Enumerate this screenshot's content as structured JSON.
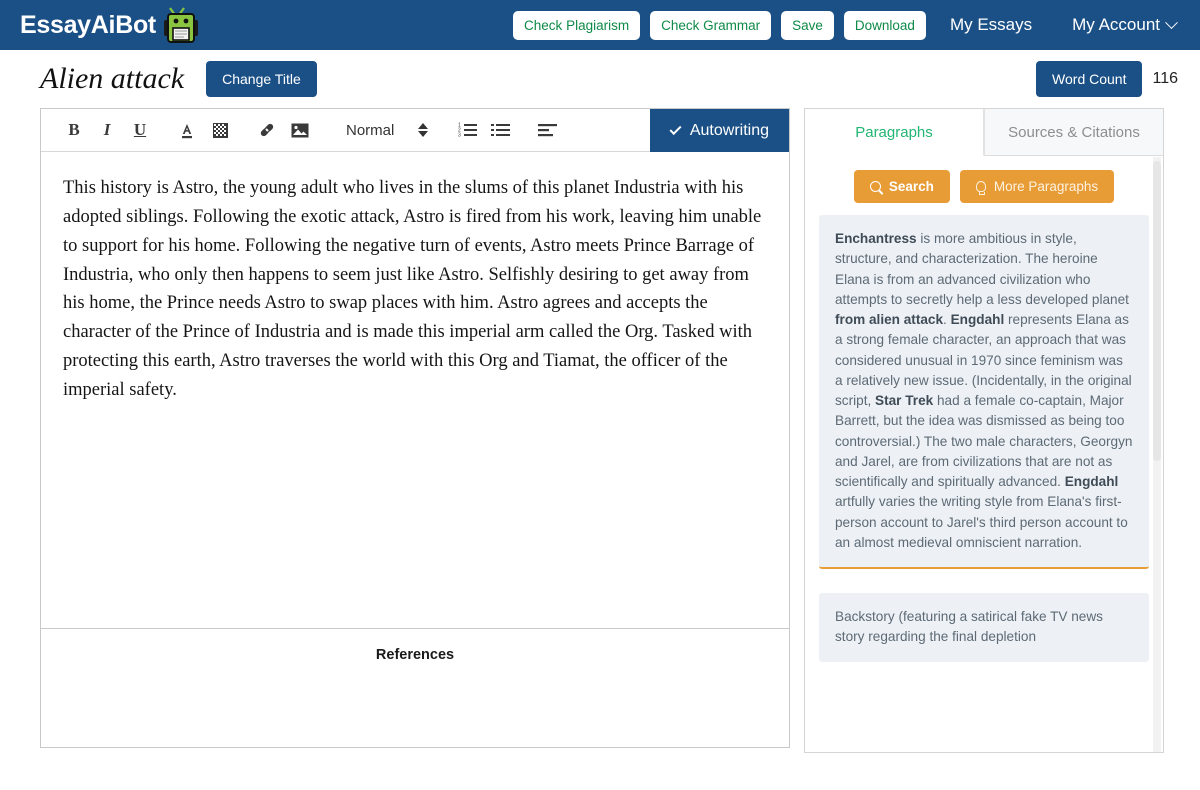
{
  "brand": {
    "name": "EssayAiBot",
    "logo_icon": "robot-icon"
  },
  "nav": {
    "buttons": [
      {
        "label": "Check Plagiarism",
        "name": "check-plagiarism-button"
      },
      {
        "label": "Check Grammar",
        "name": "check-grammar-button"
      },
      {
        "label": "Save",
        "name": "save-button"
      },
      {
        "label": "Download",
        "name": "download-button"
      }
    ],
    "links": [
      {
        "label": "My Essays"
      },
      {
        "label": "My Account"
      }
    ],
    "account_caret_icon": "chevron-down-icon"
  },
  "title_row": {
    "doc_title": "Alien attack",
    "change_title_label": "Change Title",
    "word_count_label": "Word Count",
    "word_count_value": "116"
  },
  "toolbar": {
    "icons": [
      {
        "name": "bold-icon",
        "glyph": "B"
      },
      {
        "name": "italic-icon",
        "glyph": "I"
      },
      {
        "name": "underline-icon",
        "glyph": "U"
      },
      {
        "name": "text-color-icon",
        "glyph": "A"
      },
      {
        "name": "highlight-color-icon",
        "glyph": "▒"
      },
      {
        "name": "link-icon",
        "glyph": "ὑ7"
      },
      {
        "name": "image-icon",
        "glyph": "ὛC"
      },
      {
        "name": "ordered-list-icon",
        "glyph": "list"
      },
      {
        "name": "unordered-list-icon",
        "glyph": "list"
      },
      {
        "name": "align-left-icon",
        "glyph": "align"
      }
    ],
    "style_select_value": "Normal",
    "stepper_icon": "up-down-stepper-icon",
    "autowriting_label": "Autowriting",
    "autowriting_check_icon": "check-icon"
  },
  "editor": {
    "paragraph": "This history is Astro, the young adult who lives in the slums of this planet Industria with his adopted siblings. Following the exotic attack, Astro is fired from his work, leaving him unable to support for his home. Following the negative turn of events, Astro meets Prince Barrage of Industria, who only then happens to seem just like Astro. Selfishly desiring to get away from his home, the Prince needs Astro to swap places with him. Astro agrees and accepts the character of the Prince of Industria and is made this imperial arm called the Org. Tasked with protecting this earth, Astro traverses the world with this Org and Tiamat, the officer of the imperial safety.",
    "references_heading": "References"
  },
  "side_panel": {
    "tabs": [
      {
        "label": "Paragraphs",
        "active": true
      },
      {
        "label": "Sources & Citations",
        "active": false
      }
    ],
    "search_label": "Search",
    "search_icon": "search-icon",
    "more_label": "More Paragraphs",
    "more_icon": "lightbulb-icon",
    "cards": [
      {
        "html": "<b>Enchantress</b> is more ambitious in style, structure, and characterization. The heroine Elana is from an advanced civilization who attempts to secretly help a less developed planet <b>from alien attack</b>. <b>Engdahl</b> represents Elana as a strong female character, an approach that was considered unusual in 1970 since feminism was a relatively new issue. (Incidentally, in the original script, <b>Star Trek</b> had a female co-captain, Major Barrett, but the idea was dismissed as being too controversial.) The two male characters, Georgyn and Jarel, are from civilizations that are not as scientifically and spiritually advanced. <b>Engdahl</b> artfully varies the writing style from Elana's first-person account to Jarel's third person account to an almost medieval omniscient narration."
      },
      {
        "html": "Backstory (featuring a satirical fake TV news story regarding the final depletion"
      }
    ]
  },
  "colors": {
    "brand_blue": "#1b5086",
    "accent_green": "#0f8a48",
    "tab_green": "#22b573",
    "accent_orange": "#e89c36",
    "card_bg": "#edf1f5"
  }
}
